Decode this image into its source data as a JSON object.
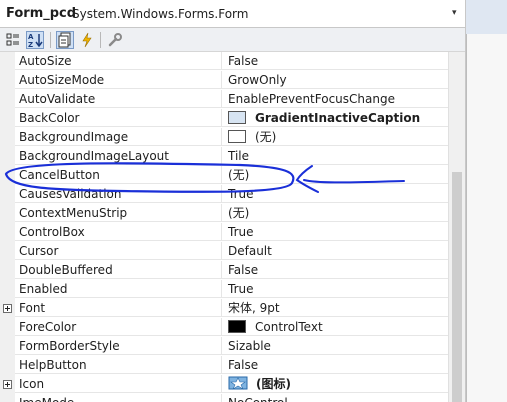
{
  "selector": {
    "object_name": "Form_pcd",
    "object_type": "System.Windows.Forms.Form",
    "dropdown_glyph": "▾"
  },
  "toolbar": {
    "items": [
      "categorized-icon",
      "alphabetical-icon",
      "properties-icon",
      "events-icon",
      "property-pages-icon"
    ]
  },
  "properties": [
    {
      "name": "AutoSize",
      "value": "False"
    },
    {
      "name": "AutoSizeMode",
      "value": "GrowOnly"
    },
    {
      "name": "AutoValidate",
      "value": "EnablePreventFocusChange"
    },
    {
      "name": "BackColor",
      "value": "GradientInactiveCaption",
      "swatch": "#d7e4f2",
      "bold": true
    },
    {
      "name": "BackgroundImage",
      "value": "(无)",
      "swatch": "#ffffff"
    },
    {
      "name": "BackgroundImageLayout",
      "value": "Tile"
    },
    {
      "name": "CancelButton",
      "value": "(无)"
    },
    {
      "name": "CausesValidation",
      "value": "True"
    },
    {
      "name": "ContextMenuStrip",
      "value": "(无)"
    },
    {
      "name": "ControlBox",
      "value": "True"
    },
    {
      "name": "Cursor",
      "value": "Default"
    },
    {
      "name": "DoubleBuffered",
      "value": "False"
    },
    {
      "name": "Enabled",
      "value": "True"
    },
    {
      "name": "Font",
      "value": "宋体, 9pt",
      "expandable": true
    },
    {
      "name": "ForeColor",
      "value": "ControlText",
      "swatch": "#000000"
    },
    {
      "name": "FormBorderStyle",
      "value": "Sizable"
    },
    {
      "name": "HelpButton",
      "value": "False"
    },
    {
      "name": "Icon",
      "value": "(图标)",
      "expandable": true,
      "icon": true,
      "bold": true
    },
    {
      "name": "ImeMode",
      "value": "NoControl"
    }
  ],
  "annotation_color": "#1a2fd8"
}
